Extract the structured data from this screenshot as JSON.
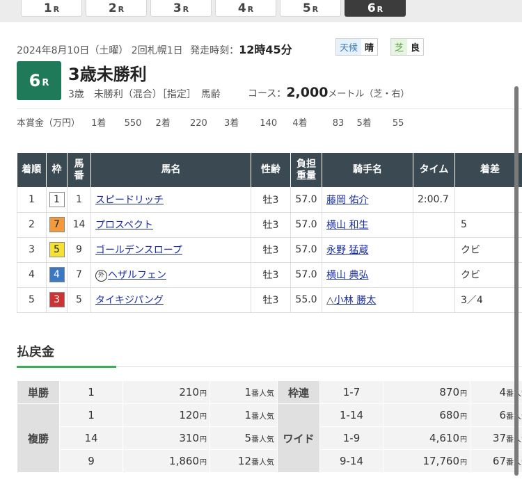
{
  "race_tabs": [
    {
      "num": "1",
      "suffix": "R",
      "active": false
    },
    {
      "num": "2",
      "suffix": "R",
      "active": false
    },
    {
      "num": "3",
      "suffix": "R",
      "active": false
    },
    {
      "num": "4",
      "suffix": "R",
      "active": false
    },
    {
      "num": "5",
      "suffix": "R",
      "active": false
    },
    {
      "num": "6",
      "suffix": "R",
      "active": true
    }
  ],
  "race": {
    "date_meet": "2024年8月10日（土曜） 2回札幌1日",
    "start_label": "発走時刻：",
    "start_time": "12時45分",
    "weather_label": "天候",
    "weather": "晴",
    "surface_label": "芝",
    "going": "良",
    "badge_num": "6",
    "badge_suffix": "R",
    "name": "3歳未勝利",
    "conditions": "3歳　未勝利（混合）［指定］　馬齢",
    "course_label": "コース：",
    "distance": "2,000",
    "course_unit": "メートル（芝・右）"
  },
  "prize": {
    "label": "本賞金（万円）",
    "items": [
      {
        "place": "1着",
        "amount": "550"
      },
      {
        "place": "2着",
        "amount": "220"
      },
      {
        "place": "3着",
        "amount": "140"
      },
      {
        "place": "4着",
        "amount": "83"
      },
      {
        "place": "5着",
        "amount": "55"
      }
    ]
  },
  "results": {
    "headers": {
      "rank": "着順",
      "waku": "枠",
      "umaban_1": "馬",
      "umaban_2": "番",
      "horse": "馬名",
      "sex_age": "性齢",
      "weight_1": "負担",
      "weight_2": "重量",
      "jockey": "騎手名",
      "time": "タイム",
      "margin": "着差"
    },
    "rows": [
      {
        "rank": "1",
        "waku": "1",
        "waku_bg": "#ffffff",
        "waku_fg": "#222222",
        "umaban": "1",
        "horse": "スピードリッチ",
        "gai": "",
        "sex_age": "牡3",
        "weight": "57.0",
        "jockey_prefix": "",
        "jockey": "藤岡 佑介",
        "time": "2:00.7",
        "margin": ""
      },
      {
        "rank": "2",
        "waku": "7",
        "waku_bg": "#f29a3c",
        "waku_fg": "#222222",
        "umaban": "14",
        "horse": "プロスペクト",
        "gai": "",
        "sex_age": "牡3",
        "weight": "57.0",
        "jockey_prefix": "",
        "jockey": "横山 和生",
        "time": "",
        "margin": "5"
      },
      {
        "rank": "3",
        "waku": "5",
        "waku_bg": "#f6e132",
        "waku_fg": "#222222",
        "umaban": "9",
        "horse": "ゴールデンスロープ",
        "gai": "",
        "sex_age": "牡3",
        "weight": "57.0",
        "jockey_prefix": "",
        "jockey": "永野 猛蔵",
        "time": "",
        "margin": "クビ"
      },
      {
        "rank": "4",
        "waku": "4",
        "waku_bg": "#3b78c4",
        "waku_fg": "#ffffff",
        "umaban": "7",
        "horse": "ヘザルフェン",
        "gai": "外",
        "sex_age": "牡3",
        "weight": "57.0",
        "jockey_prefix": "",
        "jockey": "横山 典弘",
        "time": "",
        "margin": "クビ"
      },
      {
        "rank": "5",
        "waku": "3",
        "waku_bg": "#cf3232",
        "waku_fg": "#ffffff",
        "umaban": "5",
        "horse": "タイキジパング",
        "gai": "",
        "sex_age": "牡3",
        "weight": "55.0",
        "jockey_prefix": "△",
        "jockey": "小林 勝太",
        "time": "",
        "margin": "3／4"
      }
    ]
  },
  "payout": {
    "title": "払戻金",
    "yen": "円",
    "pop_suffix": "番人気",
    "tansho": {
      "label": "単勝",
      "num": "1",
      "amount": "210",
      "pop": "1"
    },
    "fukusho": {
      "label": "複勝",
      "rows": [
        {
          "num": "1",
          "amount": "120",
          "pop": "1"
        },
        {
          "num": "14",
          "amount": "310",
          "pop": "5"
        },
        {
          "num": "9",
          "amount": "1,860",
          "pop": "12"
        }
      ]
    },
    "wakuren": {
      "label": "枠連",
      "num": "1-7",
      "amount": "870",
      "pop": "4"
    },
    "wide": {
      "label": "ワイド",
      "rows": [
        {
          "num": "1-14",
          "amount": "680",
          "pop": "6"
        },
        {
          "num": "1-9",
          "amount": "4,610",
          "pop": "37"
        },
        {
          "num": "9-14",
          "amount": "17,760",
          "pop": "67"
        }
      ]
    }
  }
}
